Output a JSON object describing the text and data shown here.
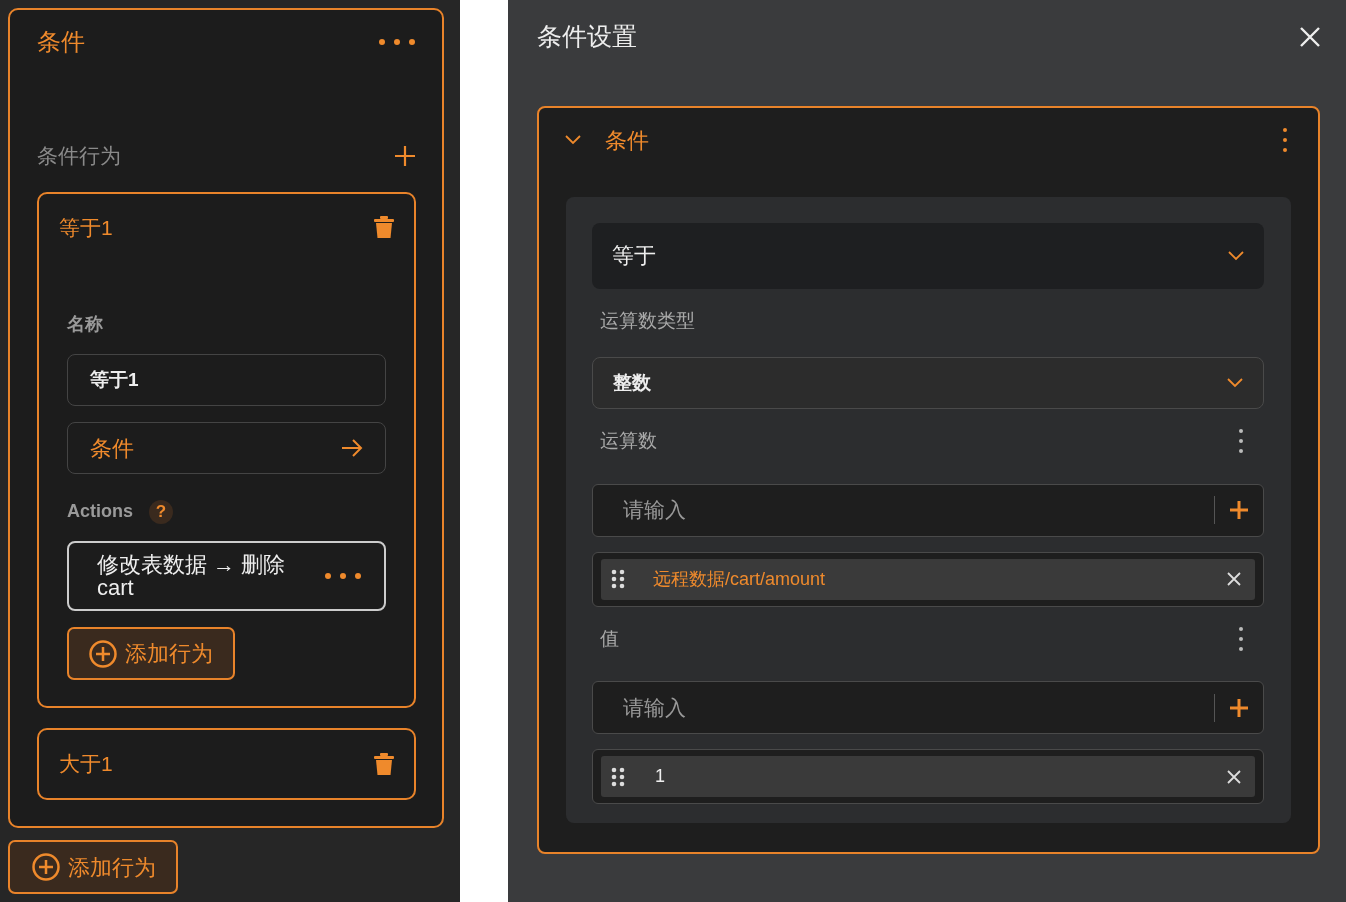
{
  "left_panel": {
    "title": "条件",
    "section_label": "条件行为",
    "behaviors": [
      {
        "title": "等于1",
        "expanded": true,
        "name_label": "名称",
        "name_value": "等于1",
        "condition_link": "条件",
        "actions_label": "Actions",
        "help_mark": "?",
        "actions": [
          {
            "text": "修改表数据 → 删除 cart"
          }
        ],
        "add_button": "添加行为"
      },
      {
        "title": "大于1",
        "expanded": false
      }
    ],
    "add_button": "添加行为"
  },
  "dialog": {
    "title": "条件设置",
    "card": {
      "title": "条件",
      "expanded": true,
      "operator": "等于",
      "operand_type_label": "运算数类型",
      "operand_type": "整数",
      "fields": [
        {
          "label": "运算数",
          "input": {
            "placeholder": "请输入"
          },
          "tag": {
            "text": "远程数据/cart/amount",
            "kind": "binding"
          }
        },
        {
          "label": "值",
          "input": {
            "placeholder": "请输入"
          },
          "tag": {
            "text": "1",
            "kind": "literal"
          }
        }
      ]
    }
  }
}
